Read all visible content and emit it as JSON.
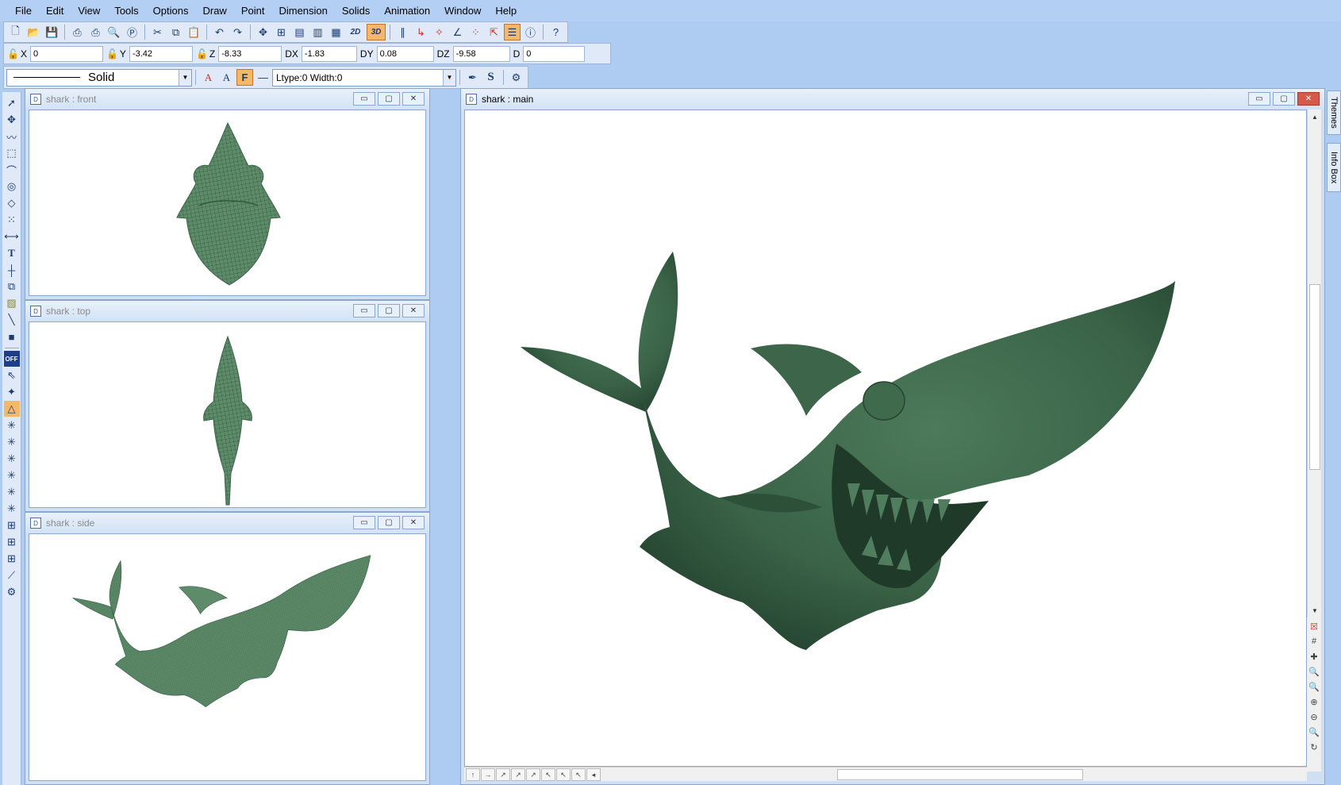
{
  "menu": [
    "File",
    "Edit",
    "View",
    "Tools",
    "Options",
    "Draw",
    "Point",
    "Dimension",
    "Solids",
    "Animation",
    "Window",
    "Help"
  ],
  "toolbar": {
    "btn_2d": "2D",
    "btn_3d": "3D"
  },
  "coords": [
    {
      "label": "X",
      "value": "0"
    },
    {
      "label": "Y",
      "value": "-3.42"
    },
    {
      "label": "Z",
      "value": "-8.33"
    },
    {
      "label": "DX",
      "value": "-1.83"
    },
    {
      "label": "DY",
      "value": "0.08"
    },
    {
      "label": "DZ",
      "value": "-9.58"
    },
    {
      "label": "D",
      "value": "0"
    }
  ],
  "style_bar": {
    "line_style": "Solid",
    "ltype_width": "Ltype:0  Width:0",
    "fill_btn": "F",
    "s_btn": "S"
  },
  "left_tools": {
    "off_label": "OFF"
  },
  "windows": {
    "front": {
      "title": "shark : front"
    },
    "top": {
      "title": "shark : top"
    },
    "side": {
      "title": "shark : side"
    },
    "main": {
      "title": "shark : main"
    }
  },
  "side_tabs": [
    "Themes",
    "Info Box"
  ],
  "colors": {
    "shark_fill": "#3d6549",
    "wire": "#4e7a5c",
    "highlight": "#f4b86a"
  }
}
